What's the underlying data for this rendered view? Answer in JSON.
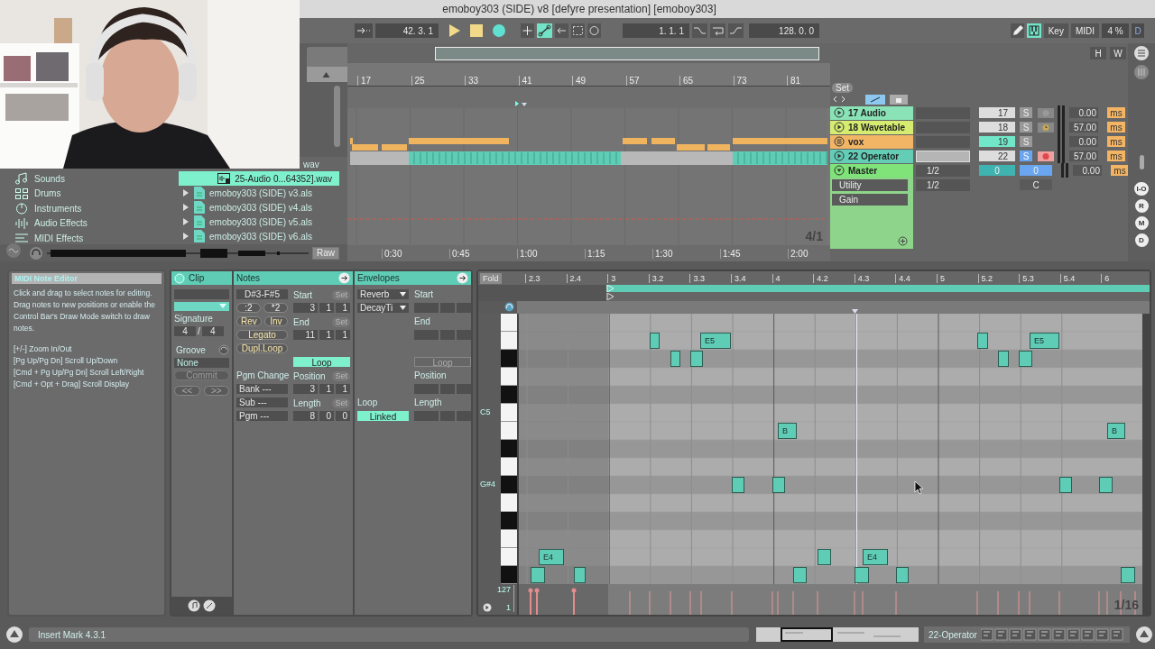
{
  "window": {
    "title": "emoboy303 (SIDE) v8 [defyre presentation]  [emoboy303]"
  },
  "control_bar": {
    "follow_position": "42. 3. 1",
    "automation_arm": {
      "on": true
    },
    "loop_start": "1. 1. 1",
    "loop_length": "128. 0. 0",
    "computer_keyboard": {
      "on": true
    },
    "key_map": "Key",
    "midi_map": "MIDI",
    "cpu": "4 %",
    "disk": "D"
  },
  "overview": {
    "buttons": [
      "H",
      "W"
    ]
  },
  "browser": {
    "categories": [
      {
        "label": "Sounds",
        "kind": "sounds"
      },
      {
        "label": "Drums",
        "kind": "drums"
      },
      {
        "label": "Instruments",
        "kind": "instruments"
      },
      {
        "label": "Audio Effects",
        "kind": "audio"
      },
      {
        "label": "MIDI Effects",
        "kind": "midi"
      }
    ],
    "files": [
      {
        "name": "wav",
        "kind": "partial",
        "selected": false
      },
      {
        "name": "25-Audio 0...64352].wav",
        "kind": "audio",
        "selected": true
      },
      {
        "name": "emoboy303 (SIDE) v3.als",
        "kind": "set",
        "selected": false
      },
      {
        "name": "emoboy303 (SIDE) v4.als",
        "kind": "set",
        "selected": false
      },
      {
        "name": "emoboy303 (SIDE) v5.als",
        "kind": "set",
        "selected": false
      },
      {
        "name": "emoboy303 (SIDE) v6.als",
        "kind": "set",
        "selected": false
      }
    ],
    "preview_button": "Raw"
  },
  "arrangement": {
    "bars": [
      "17",
      "25",
      "33",
      "41",
      "49",
      "57",
      "65",
      "73",
      "81"
    ],
    "times": [
      "0:30",
      "0:45",
      "1:00",
      "1:15",
      "1:30",
      "1:45",
      "2:00"
    ],
    "zoom": "4/1"
  },
  "mixer": {
    "set_button": "Set",
    "tracks": [
      {
        "name": "17 Audio",
        "kind": "track",
        "color": "#8ae3b6",
        "number": "17",
        "active": false,
        "solo_label": "S",
        "solo": false,
        "arm": {
          "kind": "record",
          "on": false
        },
        "delay": "0.00",
        "unit": "ms",
        "selected": false
      },
      {
        "name": "18 Wavetable",
        "kind": "track",
        "color": "#d6ec70",
        "number": "18",
        "active": false,
        "solo_label": "S",
        "solo": false,
        "arm": {
          "kind": "monitor",
          "on": false
        },
        "delay": "57.00",
        "unit": "ms",
        "selected": false
      },
      {
        "name": "vox",
        "kind": "group",
        "color": "#f2b566",
        "number": "19",
        "active": true,
        "solo_label": "S",
        "solo": false,
        "delay": "0.00",
        "unit": "ms",
        "selected": false
      },
      {
        "name": "22 Operator",
        "kind": "track",
        "color": "#63cdb6",
        "number": "22",
        "active": false,
        "solo_label": "S",
        "solo": true,
        "arm": {
          "kind": "record",
          "on": true
        },
        "delay": "57.00",
        "unit": "ms",
        "selected": true
      }
    ],
    "master": {
      "name": "Master",
      "color": "#7fe37a",
      "routing": "1/2",
      "volume": "0",
      "send": "0",
      "delay": "0.00",
      "unit": "ms",
      "devices": [
        {
          "name": "Utility",
          "routing": "1/2",
          "pan": "C"
        },
        {
          "name": "Gain"
        }
      ]
    },
    "side_buttons": [
      "I-O",
      "R",
      "M",
      "D"
    ]
  },
  "detail": {
    "info": {
      "title": "MIDI Note Editor",
      "text": "Click and drag to select notes for editing. Drag notes to new positions or enable the Control Bar's Draw Mode switch to draw notes.",
      "shortcuts": [
        "[+/-] Zoom In/Out",
        "[Pg Up/Pg Dn] Scroll Up/Down",
        "[Cmd + Pg Up/Pg Dn] Scroll Left/Right",
        "[Cmd + Opt + Drag] Scroll Display"
      ]
    },
    "clip": {
      "title": "Clip",
      "signature_label": "Signature",
      "numerator": "4",
      "slash": "/",
      "denominator": "4",
      "groove_label": "Groove",
      "groove": "None",
      "commit": {
        "label": "Commit",
        "disabled": true
      },
      "nav": [
        "<<",
        ">>"
      ]
    },
    "notes": {
      "title": "Notes",
      "range": "D#3-F#5",
      "buttons": [
        ":2",
        "*2",
        "Rev",
        "Inv",
        "Legato",
        "Dupl.Loop"
      ],
      "pgm_label": "Pgm Change",
      "pgm": [
        "Bank ---",
        "Sub ---",
        "Pgm ---"
      ],
      "fields": [
        {
          "label": "Start",
          "set": "Set",
          "values": [
            "3",
            "1",
            "1"
          ]
        },
        {
          "label": "End",
          "set": "Set",
          "values": [
            "11",
            "1",
            "1"
          ]
        },
        {
          "label": "Position",
          "set": "Set",
          "values": [
            "3",
            "1",
            "1"
          ]
        },
        {
          "label": "Length",
          "set": "Set",
          "values": [
            "8",
            "0",
            "0"
          ]
        }
      ],
      "loop": {
        "label": "Loop",
        "on": true
      }
    },
    "envelopes": {
      "title": "Envelopes",
      "device": "Reverb",
      "parameter": "DecayTi",
      "loop_label": "Loop",
      "linked": {
        "label": "Linked",
        "on": true
      },
      "fields": [
        {
          "label": "Start"
        },
        {
          "label": "End"
        },
        {
          "label": "Position"
        },
        {
          "label": "Length"
        }
      ],
      "loop": {
        "label": "Loop",
        "on": false
      }
    }
  },
  "piano_roll": {
    "fold": "Fold",
    "ruler": [
      "2.3",
      "2.4",
      "3",
      "3.2",
      "3.3",
      "3.4",
      "4",
      "4.2",
      "4.3",
      "4.4",
      "5",
      "5.2",
      "5.3",
      "5.4",
      "6"
    ],
    "key_labels": [
      "C5",
      "G#4"
    ],
    "notes": [
      {
        "label": "E5"
      },
      {
        "label": "E5"
      },
      {
        "label": "B"
      },
      {
        "label": "B"
      },
      {
        "label": "E4"
      },
      {
        "label": "E4"
      }
    ],
    "velocity_max": "127",
    "velocity_min": "1",
    "grid": "1/16"
  },
  "status_bar": {
    "message": "Insert Mark 4.3.1",
    "track": "22-Operator"
  }
}
